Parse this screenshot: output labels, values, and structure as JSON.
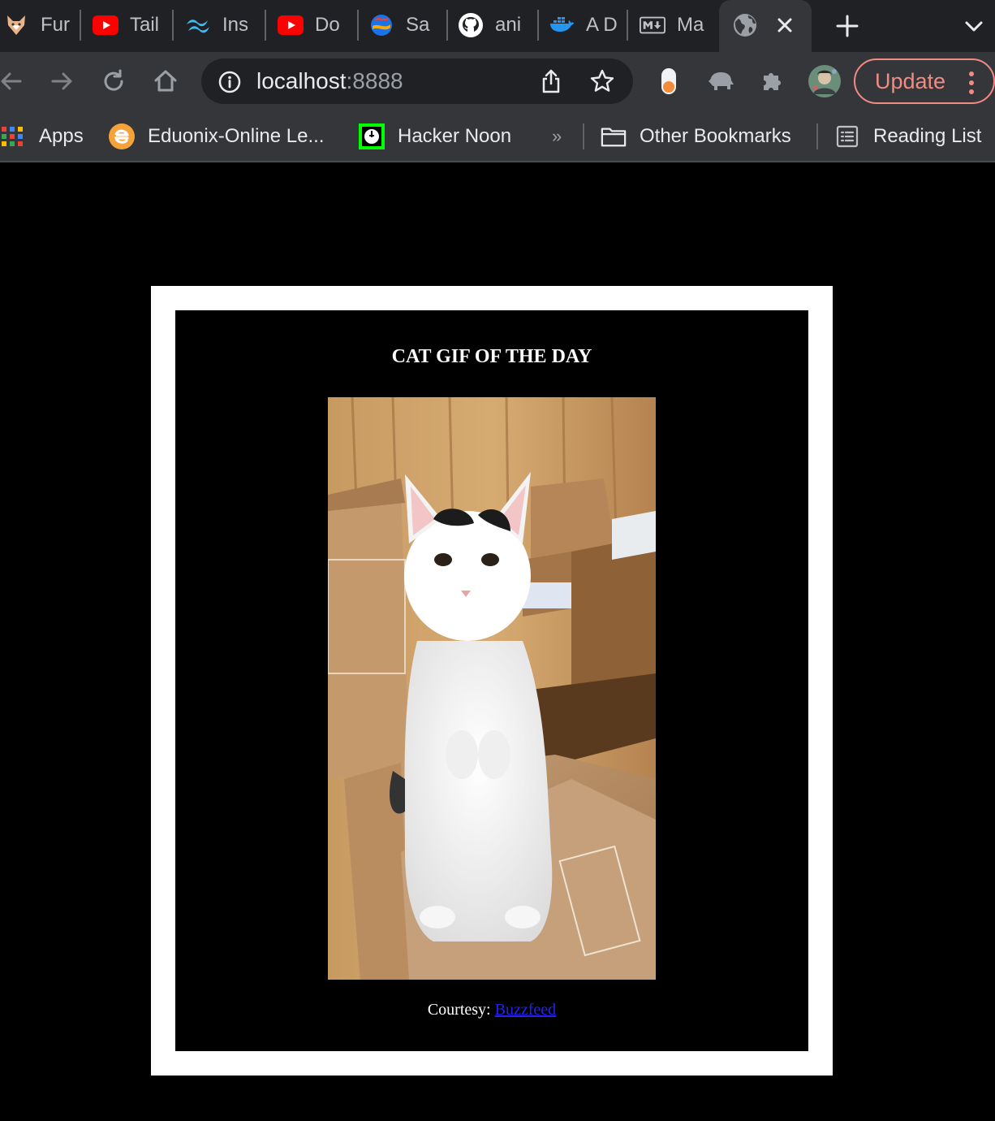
{
  "browser": {
    "tabs": [
      {
        "title": "Fur",
        "icon": "fox-icon"
      },
      {
        "title": "Tail",
        "icon": "youtube-icon"
      },
      {
        "title": "Ins",
        "icon": "tailwind-icon"
      },
      {
        "title": "Do",
        "icon": "youtube-icon"
      },
      {
        "title": "Sa",
        "icon": "globe-color-icon"
      },
      {
        "title": "ani",
        "icon": "github-icon"
      },
      {
        "title": "A D",
        "icon": "docker-icon"
      },
      {
        "title": "Ma",
        "icon": "markdown-icon"
      }
    ],
    "active_tab": {
      "icon": "globe-icon"
    },
    "omnibox": {
      "host": "localhost",
      "port": ":8888"
    },
    "update_label": "Update",
    "update_color": "#f28b82",
    "bookmarks": {
      "apps": "Apps",
      "eduonix": "Eduonix-Online Le...",
      "hackernoon": "Hacker Noon",
      "overflow": "»",
      "other": "Other Bookmarks",
      "reading": "Reading List"
    }
  },
  "page": {
    "title": "CAT GIF OF THE DAY",
    "image_alt": "cat gif",
    "courtesy_label": "Courtesy:",
    "courtesy_link": "Buzzfeed",
    "link_color": "#2323ee"
  }
}
